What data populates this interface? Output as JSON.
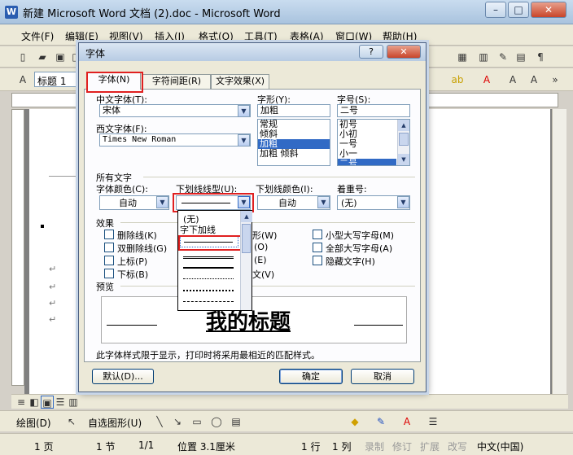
{
  "window": {
    "title": "新建 Microsoft Word 文档 (2).doc - Microsoft Word",
    "app_icon": "W",
    "controls": [
      "–",
      "□",
      "✕"
    ]
  },
  "menubar": {
    "items": [
      "文件(F)",
      "编辑(E)",
      "视图(V)",
      "插入(I)",
      "格式(O)",
      "工具(T)",
      "表格(A)",
      "窗口(W)",
      "帮助(H)"
    ]
  },
  "formatting": {
    "style": "标题 1"
  },
  "dialog": {
    "title": "字体",
    "help": "?",
    "close": "✕",
    "tabs": [
      "字体(N)",
      "字符间距(R)",
      "文字效果(X)"
    ],
    "active_tab": 0,
    "cn_font": {
      "label": "中文字体(T):",
      "value": "宋体"
    },
    "style": {
      "label": "字形(Y):",
      "value": "加粗",
      "options": [
        "常规",
        "倾斜",
        "加粗",
        "加粗 倾斜"
      ],
      "selected": 2
    },
    "size": {
      "label": "字号(S):",
      "value": "二号",
      "options": [
        "初号",
        "小初",
        "一号",
        "小一",
        "二号"
      ],
      "selected": 4
    },
    "west_font": {
      "label": "西文字体(F):",
      "value": "Times New Roman"
    },
    "all_text_heading": "所有文字",
    "font_color": {
      "label": "字体颜色(C):",
      "value": "自动"
    },
    "underline_type": {
      "label": "下划线线型(U):"
    },
    "underline_color": {
      "label": "下划线颜色(I):",
      "value": "自动"
    },
    "emphasis": {
      "label": "着重号:",
      "value": "(无)"
    },
    "underline_dropdown": {
      "none": "(无)",
      "word_only": "字下加线"
    },
    "effects_heading": "效果",
    "effects_left": [
      "删除线(K)",
      "双删除线(G)",
      "上标(P)",
      "下标(B)"
    ],
    "effects_partial": [
      "形(W)",
      "(O)",
      "(E)",
      "文(V)"
    ],
    "effects_right": [
      "小型大写字母(M)",
      "全部大写字母(A)",
      "隐藏文字(H)"
    ],
    "preview_heading": "预览",
    "preview_text": "我的标题",
    "note": "此字体样式限于显示，打印时将采用最相近的匹配样式。",
    "buttons": {
      "default": "默认(D)...",
      "ok": "确定",
      "cancel": "取消"
    }
  },
  "drawbar": {
    "draw": "绘图(D)",
    "autoshapes": "自选图形(U)"
  },
  "statusbar": {
    "page": "1 页",
    "section": "1 节",
    "pages": "1/1",
    "position": "位置 3.1厘米",
    "line": "1 行",
    "col": "1 列",
    "modes": [
      "录制",
      "修订",
      "扩展",
      "改写"
    ],
    "language": "中文(中国)"
  },
  "colors": {
    "highlight": "#e02020",
    "selection": "#316ac5"
  }
}
